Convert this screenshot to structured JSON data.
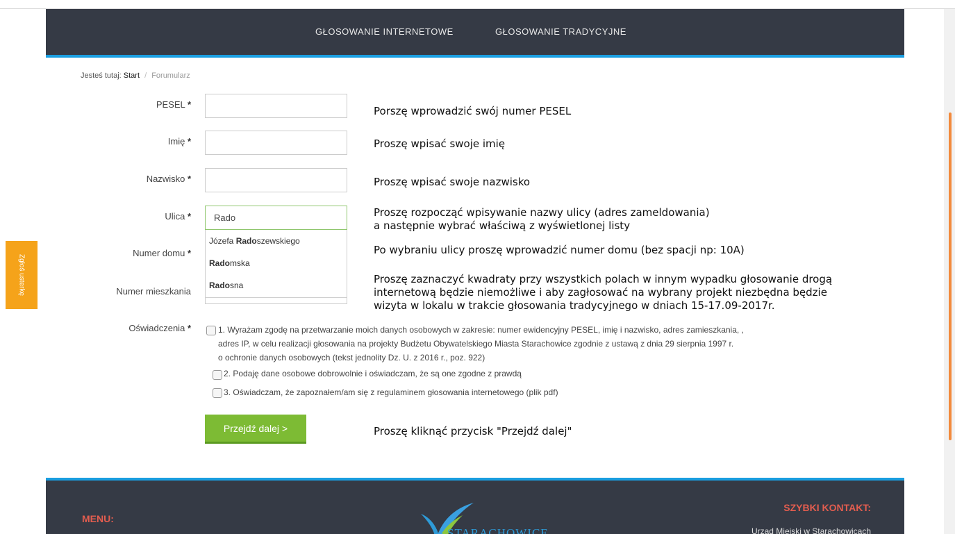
{
  "nav": {
    "items": [
      "GŁOSOWANIE INTERNETOWE",
      "GŁOSOWANIE TRADYCYJNE"
    ]
  },
  "side_tab": {
    "label": "Zgłoś usterkę"
  },
  "breadcrumb": {
    "prefix": "Jesteś tutaj:",
    "home": "Start",
    "separator": "/",
    "current": "Forumularz"
  },
  "form": {
    "required_mark": "*",
    "fields": {
      "pesel": {
        "label": "PESEL",
        "value": ""
      },
      "imie": {
        "label": "Imię",
        "value": ""
      },
      "nazwisko": {
        "label": "Nazwisko",
        "value": ""
      },
      "ulica": {
        "label": "Ulica",
        "value": "Rado"
      },
      "numer_domu": {
        "label": "Numer domu",
        "value": ""
      },
      "numer_mieszkania": {
        "label": "Numer mieszkania",
        "value": ""
      },
      "oswiadczenia": {
        "label": "Oświadczenia"
      }
    },
    "autocomplete": [
      {
        "before": "Józefa ",
        "match": "Rado",
        "after": "szewskiego"
      },
      {
        "before": "",
        "match": "Rado",
        "after": "mska"
      },
      {
        "before": "",
        "match": "Rado",
        "after": "sna"
      }
    ],
    "declarations": {
      "d1": [
        "1. Wyrażam zgodę na przetwarzanie moich danych osobowych w zakresie: numer ewidencyjny PESEL, imię i nazwisko, adres zamieszkania, ,",
        "adres IP, w celu realizacji głosowania na projekty Budżetu Obywatelskiego Miasta Starachowice zgodnie z ustawą z dnia 29 sierpnia 1997 r.",
        "o ochronie danych osobowych (tekst jednolity Dz. U. z 2016 r., poz. 922)"
      ],
      "d2": "2. Podaję dane osobowe dobrowolnie i oświadczam, że są one zgodne z prawdą",
      "d3": "3. Oświadczam, że zapoznałem/am się z regulaminem głosowania internetowego (plik pdf)"
    },
    "submit_label": "Przejdź dalej >"
  },
  "hints": {
    "pesel": "Porszę wprowadzić swój numer PESEL",
    "imie": "Proszę wpisać swoje imię",
    "nazwisko": "Proszę wpisać swoje nazwisko",
    "ulica": [
      "Proszę rozpocząć wpisywanie nazwy ulicy (adres zameldowania)",
      "a następnie wybrać właściwą z wyświetlonej listy"
    ],
    "numer_domu": "Po wybraniu ulicy proszę wprowadzić numer domu (bez spacji np: 10A)",
    "checkboxes": [
      "Proszę zaznaczyć kwadraty przy wszystkich polach w innym wypadku głosowanie drogą",
      "internetową będzie niemożliwe i aby zagłosować na wybrany projekt niezbędna będzie",
      "wizyta w lokalu w trakcie głosowania tradycyjnego w dniach 15-17.09-2017r."
    ],
    "submit": "Proszę kliknąć przycisk \"Przejdź dalej\""
  },
  "footer": {
    "menu_heading": "MENU:",
    "quick_contact_heading": "SZYBKI KONTAKT:",
    "office": "Urząd Miejski w Starachowicach",
    "logo_text": "STARACHOWICE"
  },
  "colors": {
    "nav_bg": "#353a45",
    "accent_blue": "#1a9ee0",
    "button_green": "#7dbb34",
    "side_tab_orange": "#f5a31a",
    "footer_heading_red": "#e35d4f"
  }
}
